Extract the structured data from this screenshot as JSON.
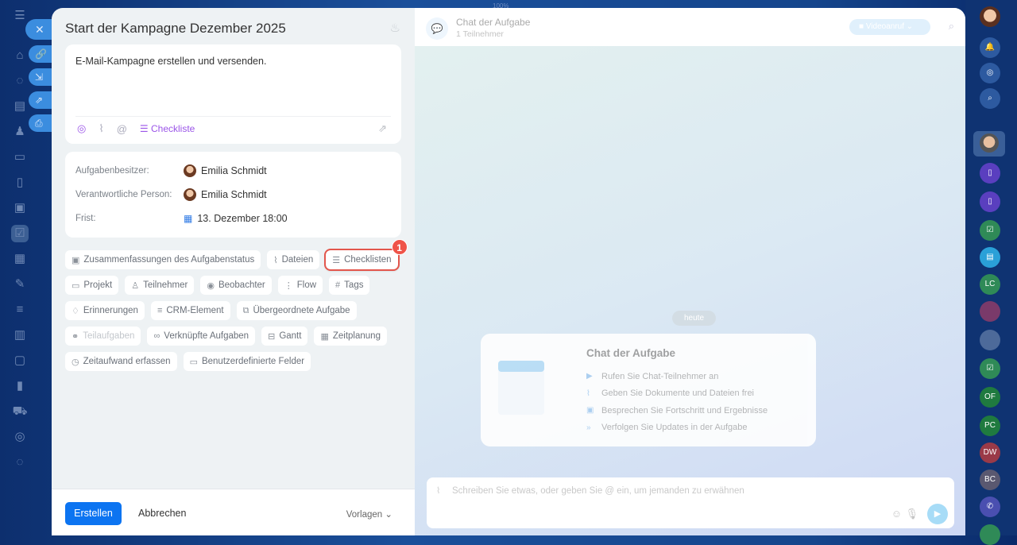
{
  "zoom_label": "100%",
  "task": {
    "title": "Start der Kampagne Dezember 2025",
    "description": "E-Mail-Kampagne erstellen und versenden.",
    "checklist_label": "Checkliste",
    "fields": [
      {
        "label": "Aufgabenbesitzer:",
        "value": "Emilia Schmidt"
      },
      {
        "label": "Verantwortliche Person:",
        "value": "Emilia Schmidt"
      },
      {
        "label": "Frist:",
        "value": "13. Dezember 18:00"
      }
    ],
    "chips": [
      [
        {
          "label": "Zusammenfassungen des Aufgabenstatus",
          "icon": "▣"
        },
        {
          "label": "Dateien",
          "icon": "⌇"
        },
        {
          "label": "Checklisten",
          "icon": "☰",
          "badge": "1"
        }
      ],
      [
        {
          "label": "Projekt",
          "icon": "▭"
        },
        {
          "label": "Teilnehmer",
          "icon": "♙"
        },
        {
          "label": "Beobachter",
          "icon": "◉"
        },
        {
          "label": "Flow",
          "icon": "⋮"
        },
        {
          "label": "Tags",
          "icon": "#"
        }
      ],
      [
        {
          "label": "Erinnerungen",
          "icon": "♢"
        },
        {
          "label": "CRM-Element",
          "icon": "≡"
        },
        {
          "label": "Übergeordnete Aufgabe",
          "icon": "⧉"
        }
      ],
      [
        {
          "label": "Teilaufgaben",
          "icon": "⚭"
        },
        {
          "label": "Verknüpfte Aufgaben",
          "icon": "∞"
        },
        {
          "label": "Gantt",
          "icon": "⊟"
        },
        {
          "label": "Zeitplanung",
          "icon": "▦"
        }
      ],
      [
        {
          "label": "Zeitaufwand erfassen",
          "icon": "◷"
        },
        {
          "label": "Benutzerdefinierte Felder",
          "icon": "▭"
        }
      ]
    ],
    "create_label": "Erstellen",
    "cancel_label": "Abbrechen",
    "templates_label": "Vorlagen"
  },
  "chat": {
    "title": "Chat der Aufgabe",
    "subtitle": "1 Teilnehmer",
    "video_label": "Videoanruf",
    "date_label": "heute",
    "intro_title": "Chat der Aufgabe",
    "intro_items": [
      "Rufen Sie Chat-Teilnehmer an",
      "Geben Sie Dokumente und Dateien frei",
      "Besprechen Sie Fortschritt und Ergebnisse",
      "Verfolgen Sie Updates in der Aufgabe"
    ],
    "input_placeholder": "Schreiben Sie etwas, oder geben Sie @ ein, um jemanden zu erwähnen"
  },
  "right_sidebar": {
    "initials": [
      "LC",
      "OF",
      "PC",
      "DW",
      "BC"
    ]
  }
}
